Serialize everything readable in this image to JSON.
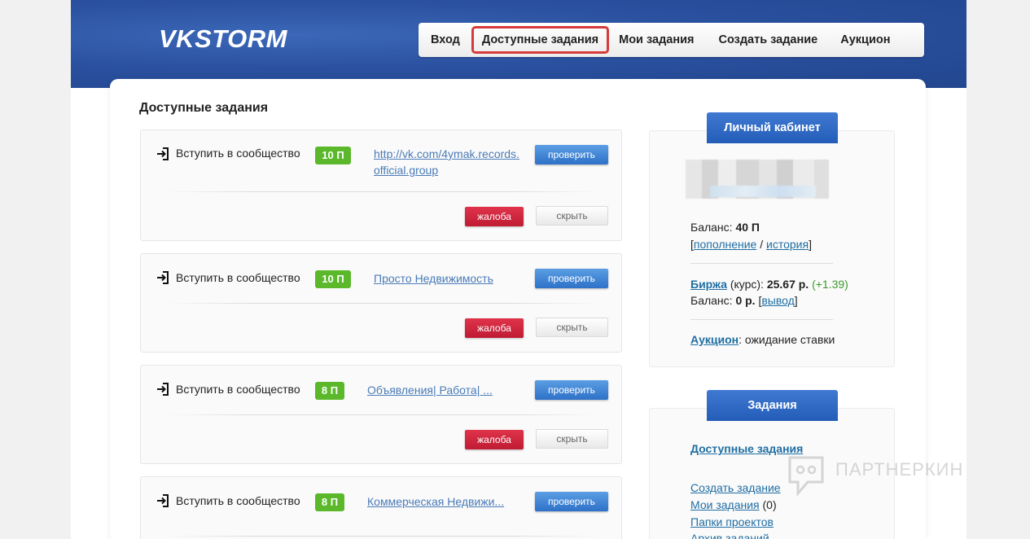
{
  "header": {
    "logo": "VKSTORM"
  },
  "nav": {
    "items": [
      {
        "label": "Вход"
      },
      {
        "label": "Доступные задания"
      },
      {
        "label": "Мои задания"
      },
      {
        "label": "Создать задание"
      },
      {
        "label": "Аукцион"
      }
    ]
  },
  "main": {
    "title": "Доступные задания",
    "tasks": [
      {
        "type": "Вступить в сообщество",
        "points": "10 П",
        "link_line1": "http://vk.com/4ymak.records.",
        "link_line2": "official.group",
        "check_label": "проверить",
        "report_label": "жалоба",
        "hide_label": "скрыть"
      },
      {
        "type": "Вступить в сообщество",
        "points": "10 П",
        "link_line1": "Просто Недвижимость",
        "check_label": "проверить",
        "report_label": "жалоба",
        "hide_label": "скрыть"
      },
      {
        "type": "Вступить в сообщество",
        "points": "8 П",
        "link_line1": "Объявления| Работа| ...",
        "check_label": "проверить",
        "report_label": "жалоба",
        "hide_label": "скрыть"
      },
      {
        "type": "Вступить в сообщество",
        "points": "8 П",
        "link_line1": "Коммерческая Недвижи...",
        "check_label": "проверить"
      }
    ]
  },
  "cabinet": {
    "header": "Личный кабинет",
    "balance_label": "Баланс:",
    "balance_value": "40 П",
    "topup_link": "пополнение",
    "history_link": "история",
    "exchange_link": "Биржа",
    "exchange_rate_label": "(курс):",
    "exchange_rate_value": "25.67 р.",
    "exchange_rate_change": "(+1.39)",
    "balance2_label": "Баланс:",
    "balance2_value": "0 р.",
    "withdraw_link": "вывод",
    "auction_link": "Аукцион",
    "auction_status": ": ожидание ставки"
  },
  "tasks_panel": {
    "header": "Задания",
    "items": [
      {
        "label": "Доступные задания"
      },
      {
        "label": "Создать задание"
      },
      {
        "label": "Мои задания",
        "count": "(0)"
      },
      {
        "label": "Папки проектов"
      },
      {
        "label": "Архив заданий"
      }
    ]
  },
  "watermark": {
    "text": "ПАРТНЕРКИН"
  }
}
